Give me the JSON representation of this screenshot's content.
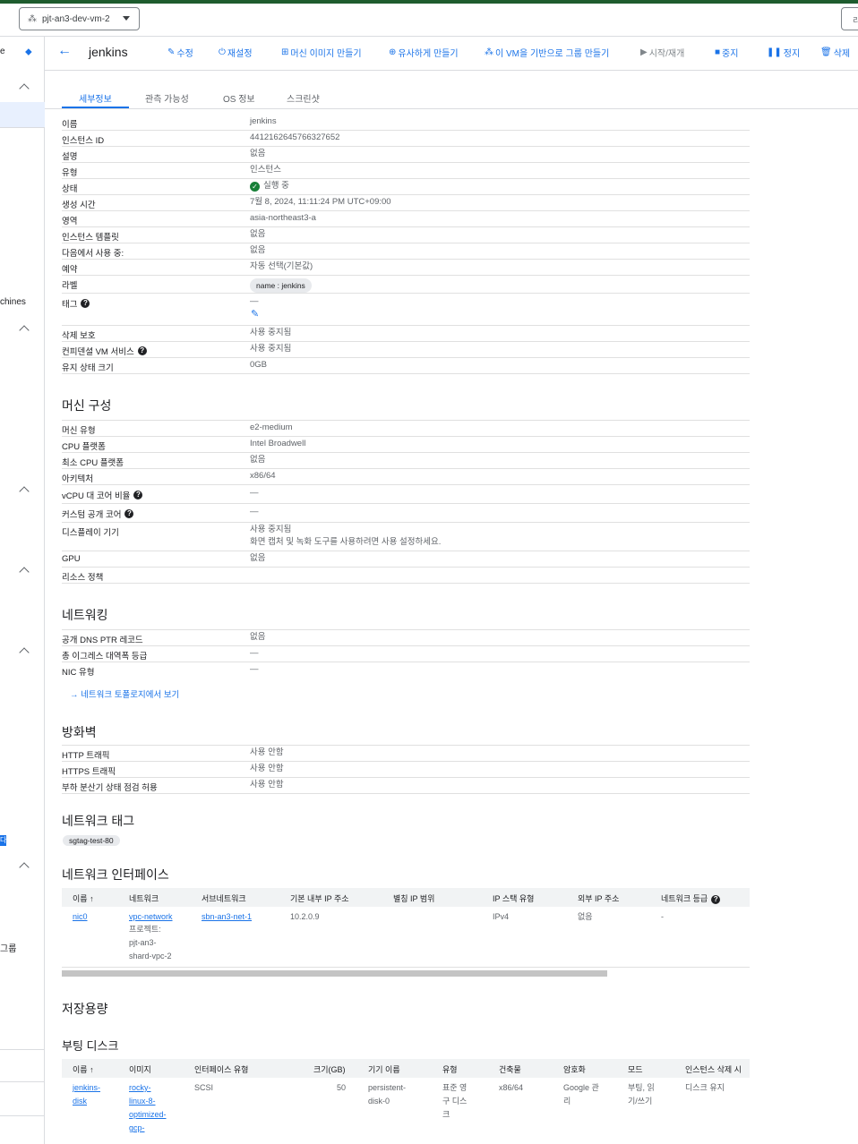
{
  "project": {
    "name": "pjt-an3-dev-vm-2"
  },
  "top_right": {
    "label": "리"
  },
  "leftnav": {
    "items": [
      "e",
      "chines",
      "그룹"
    ],
    "badge": "다"
  },
  "header": {
    "title": "jenkins",
    "actions": [
      {
        "icon": "pencil-icon",
        "label": "수정"
      },
      {
        "icon": "power-icon",
        "label": "재설정"
      },
      {
        "icon": "add-box-icon",
        "label": "머신 이미지 만들기"
      },
      {
        "icon": "bookmark-add-icon",
        "label": "유사하게 만들기"
      },
      {
        "icon": "group-icon",
        "label": "이 VM을 기반으로 그룹 만들기"
      },
      {
        "icon": "play-icon",
        "label": "시작/재개"
      },
      {
        "icon": "stop-icon",
        "label": "중지"
      },
      {
        "icon": "pause-icon",
        "label": "정지"
      },
      {
        "icon": "trash-icon",
        "label": "삭제"
      }
    ]
  },
  "tabs": [
    "세부정보",
    "관측 가능성",
    "OS 정보",
    "스크린샷"
  ],
  "details": [
    {
      "k": "이름",
      "v": "jenkins"
    },
    {
      "k": "인스턴스 ID",
      "v": "4412162645766327652"
    },
    {
      "k": "설명",
      "v": "없음"
    },
    {
      "k": "유형",
      "v": "인스턴스"
    },
    {
      "k": "상태",
      "v": "실행 중"
    },
    {
      "k": "생성 시간",
      "v": "7월 8, 2024, 11:11:24 PM UTC+09:00"
    },
    {
      "k": "영역",
      "v": "asia-northeast3-a"
    },
    {
      "k": "인스턴스 템플릿",
      "v": "없음"
    },
    {
      "k": "다음에서 사용 중:",
      "v": "없음"
    },
    {
      "k": "예약",
      "v": "자동 선택(기본값)"
    },
    {
      "k": "라벨",
      "v": "name : jenkins"
    },
    {
      "k": "태그",
      "v": "—"
    },
    {
      "k": "삭제 보호",
      "v": "사용 중지됨"
    },
    {
      "k": "컨피덴셜 VM 서비스",
      "v": "사용 중지됨"
    },
    {
      "k": "유지 상태 크기",
      "v": "0GB"
    }
  ],
  "machine": {
    "title": "머신 구성",
    "rows": [
      {
        "k": "머신 유형",
        "v": "e2-medium"
      },
      {
        "k": "CPU 플랫폼",
        "v": "Intel Broadwell"
      },
      {
        "k": "최소 CPU 플랫폼",
        "v": "없음"
      },
      {
        "k": "아키텍처",
        "v": "x86/64"
      },
      {
        "k": "vCPU 대 코어 비율",
        "v": "—"
      },
      {
        "k": "커스텀 공개 코어",
        "v": "—"
      },
      {
        "k": "디스플레이 기기",
        "v": "사용 중지됨",
        "v2": "화면 캡처 및 녹화 도구를 사용하려면 사용 설정하세요."
      },
      {
        "k": "GPU",
        "v": "없음"
      },
      {
        "k": "리소스 정책",
        "v": ""
      }
    ]
  },
  "networking": {
    "title": "네트워킹",
    "rows": [
      {
        "k": "공개 DNS PTR 레코드",
        "v": "없음"
      },
      {
        "k": "총 이그레스 대역폭 등급",
        "v": "—"
      },
      {
        "k": "NIC 유형",
        "v": "—"
      }
    ],
    "topology_link": "네트워크 토폴로지에서 보기"
  },
  "firewall": {
    "title": "방화벽",
    "rows": [
      {
        "k": "HTTP 트래픽",
        "v": "사용 안함"
      },
      {
        "k": "HTTPS 트래픽",
        "v": "사용 안함"
      },
      {
        "k": "부하 분산기 상태 점검 허용",
        "v": "사용 안함"
      }
    ]
  },
  "network_tags": {
    "title": "네트워크 태그",
    "tag": "sgtag-test-80"
  },
  "network_interfaces": {
    "title": "네트워크 인터페이스",
    "headers": [
      "이름",
      "네트워크",
      "서브네트워크",
      "기본 내부 IP 주소",
      "별칭 IP 범위",
      "IP 스택 유형",
      "외부 IP 주소",
      "네트워크 등급"
    ],
    "row": {
      "name": "nic0",
      "network": "vpc-network",
      "project_label": "프로젝트:",
      "project_lines": [
        "pjt-an3-",
        "shard-vpc-2"
      ],
      "subnetwork": "sbn-an3-net-1",
      "internal_ip": "10.2.0.9",
      "alias": "",
      "stack": "IPv4",
      "external_ip": "없음",
      "tier": "-"
    }
  },
  "storage": {
    "title": "저장용량"
  },
  "boot_disk": {
    "title": "부팅 디스크",
    "headers": [
      "이름",
      "이미지",
      "인터페이스 유형",
      "크기(GB)",
      "기기 이름",
      "유형",
      "암호화",
      "암호화",
      "모드",
      "인스턴스 삭제 시"
    ],
    "row": {
      "name_lines": [
        "jenkins-",
        "disk"
      ],
      "image_lines": [
        "rocky-",
        "linux-8-",
        "optimized-",
        "gcp-"
      ],
      "interface": "SCSI",
      "size": "50",
      "device_lines": [
        "persistent-",
        "disk-0"
      ],
      "type_lines": [
        "표준 영",
        "구 디스",
        "크"
      ],
      "arch": "x86/64",
      "encryption_lines": [
        "Google 관",
        "리"
      ],
      "mode_lines": [
        "부팅, 읽",
        "기/쓰기"
      ],
      "on_delete": "디스크 유지"
    }
  }
}
